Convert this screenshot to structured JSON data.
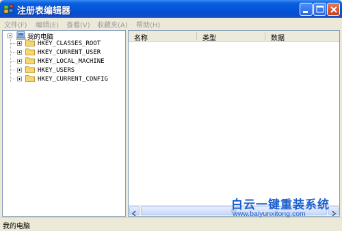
{
  "window": {
    "title": "注册表编辑器",
    "title_color": "#0453d6"
  },
  "menu": [
    {
      "label": "文件(F)"
    },
    {
      "label": "编辑(E)"
    },
    {
      "label": "查看(V)"
    },
    {
      "label": "收藏夹(A)"
    },
    {
      "label": "帮助(H)"
    }
  ],
  "tree": {
    "root": {
      "label": "我的电脑",
      "icon": "computer-icon",
      "expander": "minus"
    },
    "children": [
      {
        "label": "HKEY_CLASSES_ROOT",
        "icon": "folder-icon",
        "expander": "plus"
      },
      {
        "label": "HKEY_CURRENT_USER",
        "icon": "folder-icon",
        "expander": "plus"
      },
      {
        "label": "HKEY_LOCAL_MACHINE",
        "icon": "folder-icon",
        "expander": "plus"
      },
      {
        "label": "HKEY_USERS",
        "icon": "folder-icon",
        "expander": "plus"
      },
      {
        "label": "HKEY_CURRENT_CONFIG",
        "icon": "folder-icon",
        "expander": "plus"
      }
    ]
  },
  "list": {
    "columns": [
      {
        "label": "名称"
      },
      {
        "label": "类型"
      },
      {
        "label": "数据"
      }
    ]
  },
  "statusbar": {
    "text": "我的电脑"
  },
  "watermark": {
    "title": "白云一键重装系统",
    "url": "www.baiyunxitong.com",
    "color": "#1a5fcf"
  },
  "colors": {
    "folder": "#f5d76e",
    "pane_border": "#7f9db9",
    "chrome": "#ece9d8"
  }
}
